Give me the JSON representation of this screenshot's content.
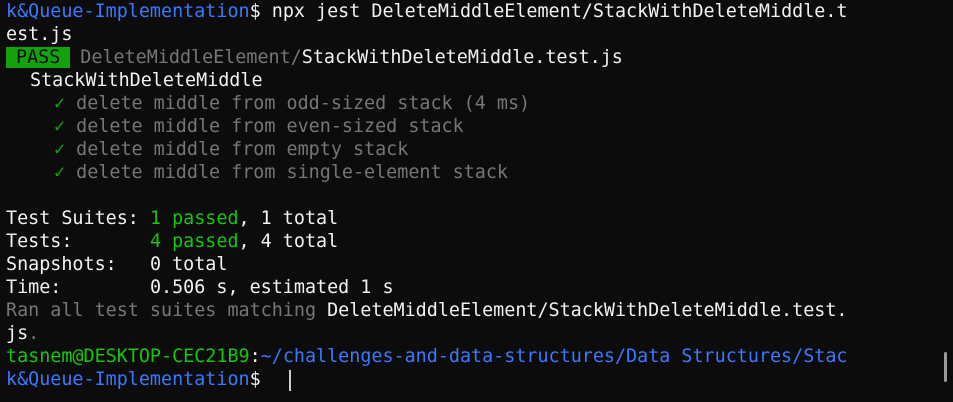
{
  "terminal": {
    "lines": {
      "l1_path_tail": "k&Queue-Implementation",
      "l1_prompt": "$ ",
      "l1_command": "npx jest DeleteMiddleElement/StackWithDeleteMiddle.t",
      "l2_command_wrap": "est.js",
      "pass_badge": "PASS",
      "pass_dir": "DeleteMiddleElement/",
      "pass_file": "StackWithDeleteMiddle.test.js",
      "suite_name": "StackWithDeleteMiddle",
      "tests": [
        {
          "check": "✓",
          "name": "delete middle from odd-sized stack (4 ms)"
        },
        {
          "check": "✓",
          "name": "delete middle from even-sized stack"
        },
        {
          "check": "✓",
          "name": "delete middle from empty stack"
        },
        {
          "check": "✓",
          "name": "delete middle from single-element stack"
        }
      ],
      "summary": {
        "suites_label": "Test Suites: ",
        "suites_passed": "1 passed",
        "suites_rest": ", 1 total",
        "tests_label": "Tests:       ",
        "tests_passed": "4 passed",
        "tests_rest": ", 4 total",
        "snapshots_label": "Snapshots:   ",
        "snapshots_value": "0 total",
        "time_label": "Time:        ",
        "time_value": "0.506 s, estimated 1 s"
      },
      "ran_prefix": "Ran all test suites matching ",
      "ran_pattern": "DeleteMiddleElement/StackWithDeleteMiddle.test.",
      "ran_wrap": "js",
      "ran_wrap_dot": ".",
      "prompt_user": "tasnem@DESKTOP-CEC21B9",
      "prompt_colon": ":",
      "prompt_path": "~/challenges-and-data-structures/Data Structures/Stac",
      "prompt_path_wrap": "k&Queue-Implementation",
      "prompt_symbol": "$ "
    }
  },
  "colors": {
    "background": "#0c0c0c",
    "foreground": "#cccccc",
    "green": "#13a10e",
    "bright_green": "#16c60c",
    "blue": "#3b78ff",
    "dim": "#767676"
  }
}
